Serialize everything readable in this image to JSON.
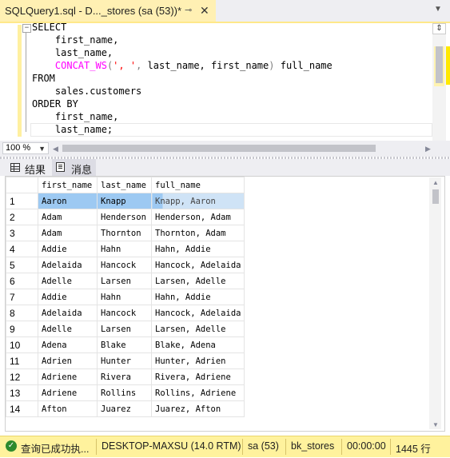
{
  "tab": {
    "title": "SQLQuery1.sql - D..._stores (sa (53))*",
    "pin_icon": "pin-icon",
    "close_icon": "close-icon"
  },
  "tabstrip": {
    "menu_icon": "chevron-down-icon"
  },
  "editor": {
    "outline_symbol": "−",
    "lines": {
      "l1": "SELECT",
      "l2": "    first_name,",
      "l3": "    last_name,",
      "l4_fn": "CONCAT_WS",
      "l4_str": "', '",
      "l4_rest": " last_name, first_name",
      "l4_alias": " full_name",
      "l5": "FROM",
      "l6": "    sales.customers",
      "l7": "ORDER BY",
      "l8": "    first_name,",
      "l9": "    last_name;"
    },
    "split_icon": "splitter-icon"
  },
  "zoom": {
    "value": "100 %"
  },
  "results_tabs": {
    "results": "结果",
    "messages": "消息"
  },
  "grid": {
    "columns": [
      "first_name",
      "last_name",
      "full_name"
    ],
    "rows": [
      {
        "n": "1",
        "first": "Aaron",
        "last": "Knapp",
        "full": "Knapp, Aaron"
      },
      {
        "n": "2",
        "first": "Adam",
        "last": "Henderson",
        "full": "Henderson, Adam"
      },
      {
        "n": "3",
        "first": "Adam",
        "last": "Thornton",
        "full": "Thornton, Adam"
      },
      {
        "n": "4",
        "first": "Addie",
        "last": "Hahn",
        "full": "Hahn, Addie"
      },
      {
        "n": "5",
        "first": "Adelaida",
        "last": "Hancock",
        "full": "Hancock, Adelaida"
      },
      {
        "n": "6",
        "first": "Adelle",
        "last": "Larsen",
        "full": "Larsen, Adelle"
      },
      {
        "n": "7",
        "first": "Addie",
        "last": "Hahn",
        "full": "Hahn, Addie"
      },
      {
        "n": "8",
        "first": "Adelaida",
        "last": "Hancock",
        "full": "Hancock, Adelaida"
      },
      {
        "n": "9",
        "first": "Adelle",
        "last": "Larsen",
        "full": "Larsen, Adelle"
      },
      {
        "n": "10",
        "first": "Adena",
        "last": "Blake",
        "full": "Blake, Adena"
      },
      {
        "n": "11",
        "first": "Adrien",
        "last": "Hunter",
        "full": "Hunter, Adrien"
      },
      {
        "n": "12",
        "first": "Adriene",
        "last": "Rivera",
        "full": "Rivera, Adriene"
      },
      {
        "n": "13",
        "first": "Adriene",
        "last": "Rollins",
        "full": "Rollins, Adriene"
      },
      {
        "n": "14",
        "first": "Afton",
        "last": "Juarez",
        "full": "Juarez, Afton"
      }
    ]
  },
  "status": {
    "message": "查询已成功执...",
    "server": "DESKTOP-MAXSU (14.0 RTM)",
    "user": "sa (53)",
    "database": "bk_stores",
    "elapsed": "00:00:00",
    "rows": "1445 行"
  },
  "colors": {
    "accent": "#fff29d",
    "selection": "#9dc9f2",
    "keyword": "#0000ff",
    "function": "#ff00ff",
    "string": "#ff0000"
  }
}
